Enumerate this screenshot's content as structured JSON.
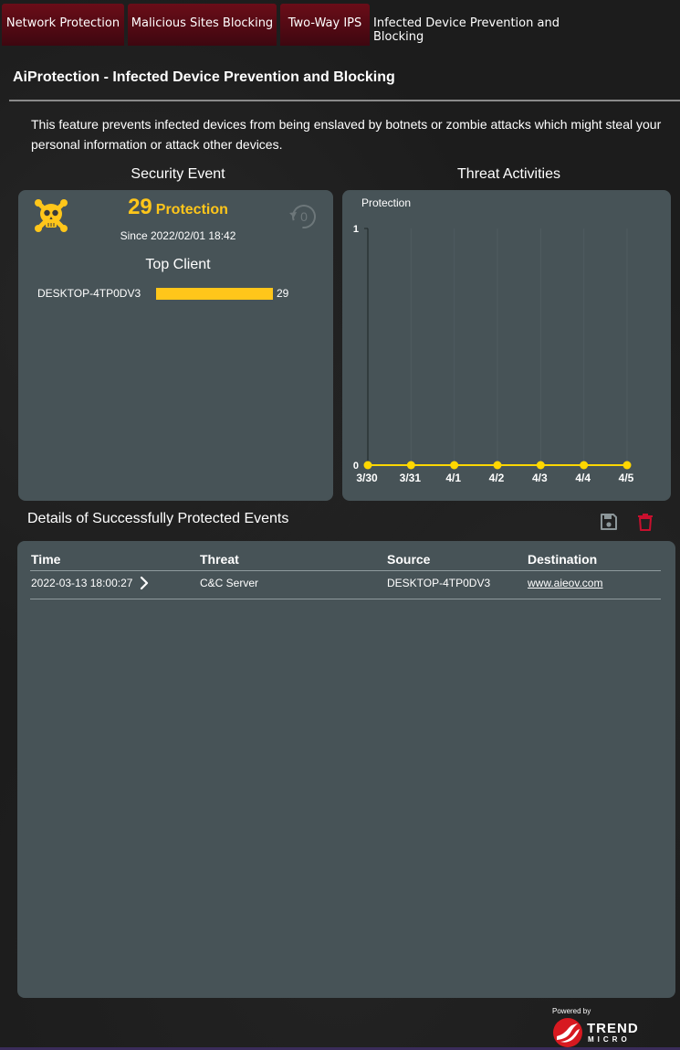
{
  "tabs": [
    {
      "label": "Network Protection",
      "active": false
    },
    {
      "label": "Malicious Sites Blocking",
      "active": false
    },
    {
      "label": "Two-Way IPS",
      "active": false
    },
    {
      "label": "Infected Device Prevention and Blocking",
      "active": true
    }
  ],
  "page_title": "AiProtection - Infected Device Prevention and Blocking",
  "description": "This feature prevents infected devices from being enslaved by botnets or zombie attacks which might steal your personal information or attack other devices.",
  "security_event": {
    "heading": "Security Event",
    "count": "29",
    "count_label": "Protection",
    "since": "Since 2022/02/01 18:42",
    "reset_label": "0",
    "top_client_heading": "Top Client",
    "top_clients": [
      {
        "name": "DESKTOP-4TP0DV3",
        "count": "29",
        "fraction": 1.0
      }
    ]
  },
  "threat_activities": {
    "heading": "Threat Activities"
  },
  "chart_data": {
    "type": "line",
    "title": "",
    "series_label": "Protection",
    "categories": [
      "3/30",
      "3/31",
      "4/1",
      "4/2",
      "4/3",
      "4/4",
      "4/5"
    ],
    "series": [
      {
        "values": [
          0,
          0,
          0,
          0,
          0,
          0,
          0
        ]
      }
    ],
    "ylim": [
      0,
      1
    ],
    "yticks": [
      "0",
      "1"
    ],
    "grid": true,
    "color": "#ffd700"
  },
  "details": {
    "heading": "Details of Successfully Protected Events",
    "columns": [
      "Time",
      "Threat",
      "Source",
      "Destination"
    ],
    "rows": [
      {
        "time": "2022-03-13 18:00:27",
        "threat": "C&C Server",
        "source": "DESKTOP-4TP0DV3",
        "destination": "www.aieov.com"
      }
    ]
  },
  "footer": {
    "powered_by": "Powered by",
    "brand_line1": "TREND",
    "brand_line2": "MICRO"
  },
  "colors": {
    "accent": "#ffc61a",
    "panel": "#475357",
    "tab_bg": "#5a0b15",
    "delete": "#c8102e"
  }
}
